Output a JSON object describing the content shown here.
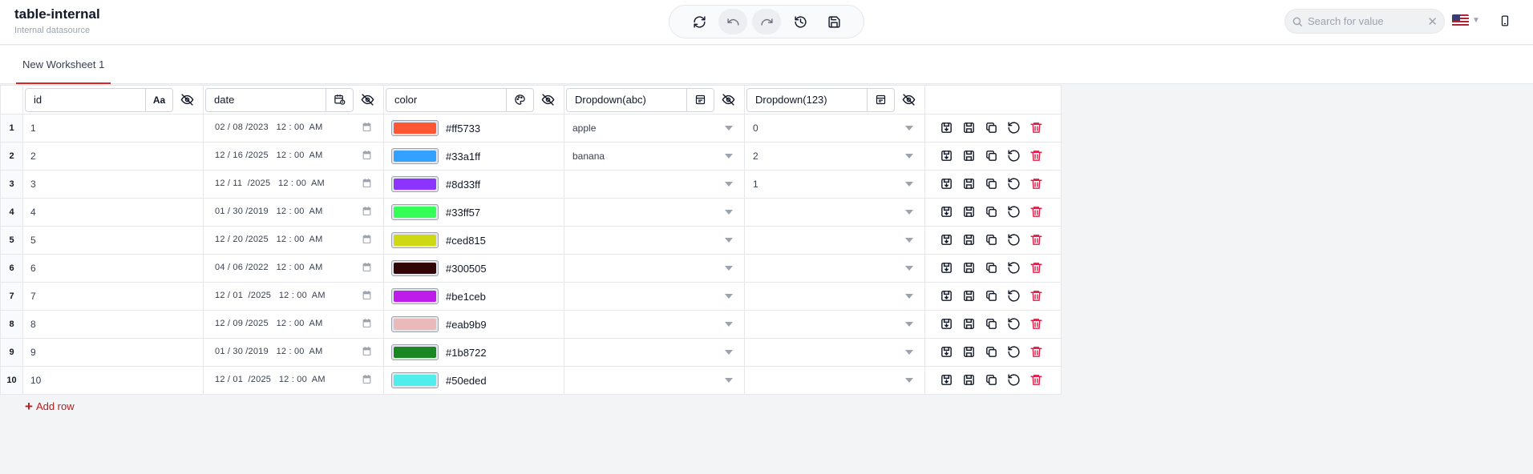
{
  "app": {
    "title": "table-internal",
    "subtitle": "Internal datasource"
  },
  "toolbar": {
    "buttons": [
      "refresh-icon",
      "undo-icon",
      "redo-icon",
      "history-icon",
      "save-icon"
    ]
  },
  "search": {
    "placeholder": "Search for value"
  },
  "tabs": [
    {
      "label": "New Worksheet 1",
      "active": true
    }
  ],
  "columns": [
    {
      "name": "id",
      "type_icon": "Aa"
    },
    {
      "name": "date",
      "type_icon": "calendar-clock-icon"
    },
    {
      "name": "color",
      "type_icon": "palette-icon"
    },
    {
      "name": "Dropdown(abc)",
      "type_icon": "dropdown-icon"
    },
    {
      "name": "Dropdown(123)",
      "type_icon": "dropdown-icon"
    }
  ],
  "rows": [
    {
      "n": "1",
      "id": "1",
      "date": "02 / 08 /2023   12 : 00  AM",
      "color": "#ff5733",
      "dd_abc": "apple",
      "dd_123": "0"
    },
    {
      "n": "2",
      "id": "2",
      "date": "12 / 16 /2025   12 : 00  AM",
      "color": "#33a1ff",
      "dd_abc": "banana",
      "dd_123": "2"
    },
    {
      "n": "3",
      "id": "3",
      "date": "12 / 11  /2025   12 : 00  AM",
      "color": "#8d33ff",
      "dd_abc": "",
      "dd_123": "1"
    },
    {
      "n": "4",
      "id": "4",
      "date": "01 / 30 /2019   12 : 00  AM",
      "color": "#33ff57",
      "dd_abc": "",
      "dd_123": ""
    },
    {
      "n": "5",
      "id": "5",
      "date": "12 / 20 /2025   12 : 00  AM",
      "color": "#ced815",
      "dd_abc": "",
      "dd_123": ""
    },
    {
      "n": "6",
      "id": "6",
      "date": "04 / 06 /2022   12 : 00  AM",
      "color": "#300505",
      "dd_abc": "",
      "dd_123": ""
    },
    {
      "n": "7",
      "id": "7",
      "date": "12 / 01  /2025   12 : 00  AM",
      "color": "#be1ceb",
      "dd_abc": "",
      "dd_123": ""
    },
    {
      "n": "8",
      "id": "8",
      "date": "12 / 09 /2025   12 : 00  AM",
      "color": "#eab9b9",
      "dd_abc": "",
      "dd_123": ""
    },
    {
      "n": "9",
      "id": "9",
      "date": "01 / 30 /2019   12 : 00  AM",
      "color": "#1b8722",
      "dd_abc": "",
      "dd_123": ""
    },
    {
      "n": "10",
      "id": "10",
      "date": "12 / 01  /2025   12 : 00  AM",
      "color": "#50eded",
      "dd_abc": "",
      "dd_123": ""
    }
  ],
  "row_actions": [
    "save-row-icon",
    "save-as-icon",
    "duplicate-icon",
    "revert-icon",
    "delete-icon"
  ],
  "add_row": {
    "label": "Add row"
  },
  "colors": {
    "accent": "#dc2626",
    "delete": "#e11d48"
  }
}
